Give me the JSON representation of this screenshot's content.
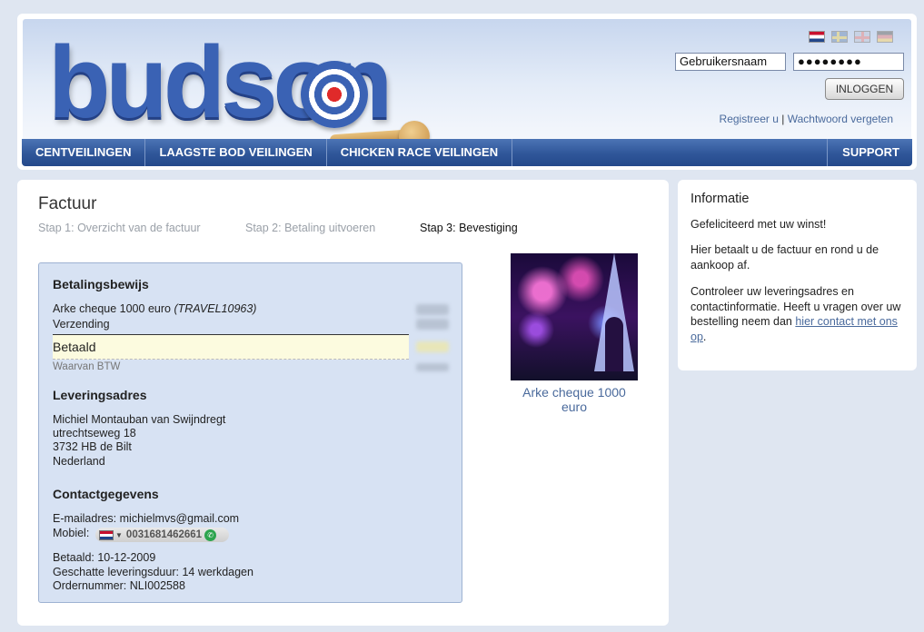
{
  "header": {
    "logo_text": "budson",
    "flags": [
      "nl-flag-icon",
      "se-flag-icon",
      "uk-flag-icon",
      "de-flag-icon"
    ],
    "username_value": "Gebruikersnaam",
    "password_value": "●●●●●●●●",
    "login_button": "INLOGGEN",
    "register_link": "Registreer u",
    "separator": "|",
    "forgot_link": "Wachtwoord vergeten"
  },
  "nav": {
    "items": [
      "CENTVEILINGEN",
      "LAAGSTE BOD VEILINGEN",
      "CHICKEN RACE VEILINGEN"
    ],
    "support": "SUPPORT"
  },
  "main": {
    "title": "Factuur",
    "steps": [
      "Stap 1: Overzicht van de factuur",
      "Stap 2: Betaling uitvoeren",
      "Stap 3: Bevestiging"
    ],
    "payment_title": "Betalingsbewijs",
    "item_name": "Arke cheque 1000 euro ",
    "item_code": "(TRAVEL10963)",
    "shipping": "Verzending",
    "paid": "Betaald",
    "vat": "Waarvan BTW",
    "delivery_title": "Leveringsadres",
    "address": [
      "Michiel Montauban van Swijndregt",
      "utrechtseweg 18",
      "3732 HB de Bilt",
      "Nederland"
    ],
    "contact_title": "Contactgegevens",
    "email": "E-mailadres: michielmvs@gmail.com",
    "mobile_label": "Mobiel:",
    "mobile_number": "0031681462661",
    "paid_date": "Betaald: 10-12-2009",
    "delivery_time": "Geschatte leveringsduur: 14 werkdagen",
    "order_number": "Ordernummer: NLI002588"
  },
  "product": {
    "caption": "Arke cheque 1000 euro"
  },
  "sidebar": {
    "title": "Informatie",
    "p1": "Gefeliciteerd met uw winst!",
    "p2": "Hier betaalt u de factuur en rond u de aankoop af.",
    "p3_text": "Controleer uw leveringsadres en contactinformatie. Heeft u vragen over uw bestelling neem dan ",
    "p3_link": "hier contact met ons op",
    "p3_end": "."
  },
  "colors": {
    "brand_blue": "#3a62b4",
    "nav_blue": "#2f5699",
    "box_bg": "#d7e2f3",
    "link": "#4a6a9c"
  }
}
